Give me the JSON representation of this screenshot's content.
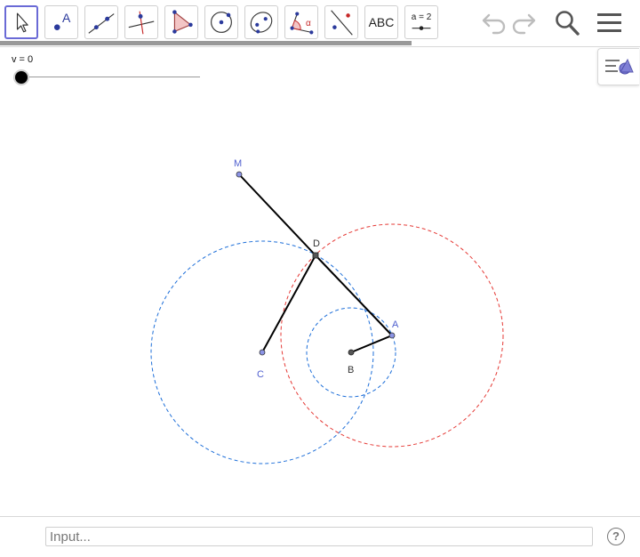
{
  "toolbar": {
    "tools": [
      {
        "name": "move-tool",
        "icon": "arrow-cursor-icon",
        "selected": true
      },
      {
        "name": "point-tool",
        "icon": "point-icon",
        "label": "A"
      },
      {
        "name": "line-tool",
        "icon": "line-through-points-icon"
      },
      {
        "name": "perpendicular-line-tool",
        "icon": "perpendicular-line-icon"
      },
      {
        "name": "polygon-tool",
        "icon": "polygon-icon"
      },
      {
        "name": "circle-center-point-tool",
        "icon": "circle-center-point-icon"
      },
      {
        "name": "ellipse-tool",
        "icon": "ellipse-icon"
      },
      {
        "name": "angle-tool",
        "icon": "angle-icon",
        "label": "α"
      },
      {
        "name": "reflect-tool",
        "icon": "reflect-about-line-icon"
      },
      {
        "name": "text-tool",
        "label": "ABC"
      },
      {
        "name": "slider-tool",
        "label": "a = 2"
      }
    ],
    "undo_icon": "undo-icon",
    "redo_icon": "redo-icon",
    "search_icon": "search-icon",
    "menu_icon": "hamburger-menu-icon"
  },
  "algebra_toggle_icon": "algebra-view-toggle-icon",
  "slider": {
    "label": "v = 0",
    "value": 0
  },
  "construction": {
    "points": {
      "M": {
        "label": "M",
        "color": "#4f5fcf"
      },
      "D": {
        "label": "D",
        "color": "#333333"
      },
      "A": {
        "label": "A",
        "color": "#4f5fcf"
      },
      "B": {
        "label": "B",
        "color": "#333333"
      },
      "C": {
        "label": "C",
        "color": "#4f5fcf"
      }
    },
    "circle_color_blue": "#1565c0",
    "circle_color_red": "#d32f2f"
  },
  "input_bar": {
    "placeholder": "Input...",
    "help_icon": "help-icon",
    "help_label": "?"
  }
}
